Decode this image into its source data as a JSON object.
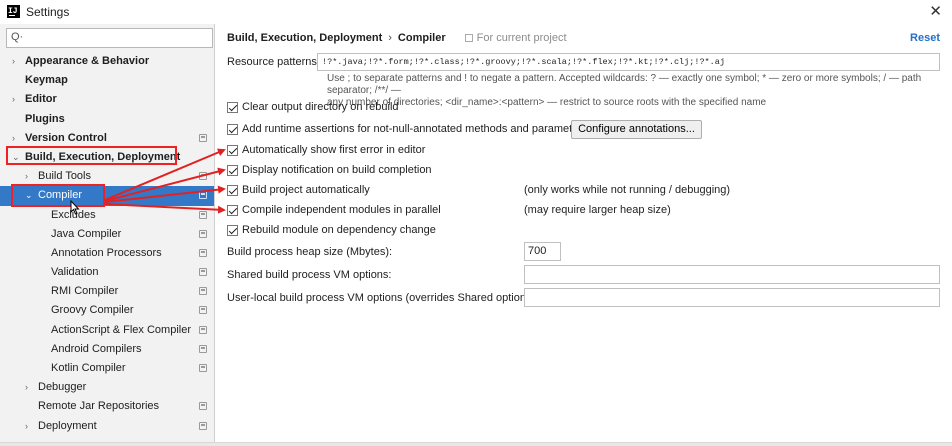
{
  "window": {
    "title": "Settings",
    "app_icon": "intellij-icon",
    "close_icon": "close-icon"
  },
  "search": {
    "placeholder": "",
    "value": "",
    "icon": "search-icon"
  },
  "tree": [
    {
      "label": "Appearance & Behavior",
      "bold": true,
      "expanded": false,
      "has_arrow": true,
      "indent": 0,
      "project_icon": false
    },
    {
      "label": "Keymap",
      "bold": true,
      "has_arrow": false,
      "indent": 0,
      "project_icon": false
    },
    {
      "label": "Editor",
      "bold": true,
      "expanded": false,
      "has_arrow": true,
      "indent": 0,
      "project_icon": false
    },
    {
      "label": "Plugins",
      "bold": true,
      "has_arrow": false,
      "indent": 0,
      "project_icon": false
    },
    {
      "label": "Version Control",
      "bold": true,
      "expanded": false,
      "has_arrow": true,
      "indent": 0,
      "project_icon": true
    },
    {
      "label": "Build, Execution, Deployment",
      "bold": true,
      "expanded": true,
      "has_arrow": true,
      "indent": 0,
      "project_icon": false
    },
    {
      "label": "Build Tools",
      "bold": false,
      "expanded": false,
      "has_arrow": true,
      "indent": 1,
      "project_icon": true
    },
    {
      "label": "Compiler",
      "bold": false,
      "expanded": true,
      "has_arrow": true,
      "indent": 1,
      "project_icon": true,
      "selected": true
    },
    {
      "label": "Excludes",
      "bold": false,
      "has_arrow": false,
      "indent": 2,
      "project_icon": true
    },
    {
      "label": "Java Compiler",
      "bold": false,
      "has_arrow": false,
      "indent": 2,
      "project_icon": true
    },
    {
      "label": "Annotation Processors",
      "bold": false,
      "has_arrow": false,
      "indent": 2,
      "project_icon": true
    },
    {
      "label": "Validation",
      "bold": false,
      "has_arrow": false,
      "indent": 2,
      "project_icon": true
    },
    {
      "label": "RMI Compiler",
      "bold": false,
      "has_arrow": false,
      "indent": 2,
      "project_icon": true
    },
    {
      "label": "Groovy Compiler",
      "bold": false,
      "has_arrow": false,
      "indent": 2,
      "project_icon": true
    },
    {
      "label": "ActionScript & Flex Compiler",
      "bold": false,
      "has_arrow": false,
      "indent": 2,
      "project_icon": true
    },
    {
      "label": "Android Compilers",
      "bold": false,
      "has_arrow": false,
      "indent": 2,
      "project_icon": true
    },
    {
      "label": "Kotlin Compiler",
      "bold": false,
      "has_arrow": false,
      "indent": 2,
      "project_icon": true
    },
    {
      "label": "Debugger",
      "bold": false,
      "expanded": false,
      "has_arrow": true,
      "indent": 1,
      "project_icon": false
    },
    {
      "label": "Remote Jar Repositories",
      "bold": false,
      "has_arrow": false,
      "indent": 1,
      "project_icon": true
    },
    {
      "label": "Deployment",
      "bold": false,
      "expanded": false,
      "has_arrow": true,
      "indent": 1,
      "project_icon": true
    }
  ],
  "header": {
    "crumb_parent": "Build, Execution, Deployment",
    "crumb_sep": "›",
    "crumb_current": "Compiler",
    "scope": "For current project",
    "reset": "Reset"
  },
  "resource_patterns": {
    "label": "Resource patterns:",
    "value": "!?*.java;!?*.form;!?*.class;!?*.groovy;!?*.scala;!?*.flex;!?*.kt;!?*.clj;!?*.aj",
    "hint_line1": "Use ; to separate patterns and ! to negate a pattern. Accepted wildcards: ? — exactly one symbol; * — zero or more symbols; / — path separator; /**/ —",
    "hint_line2": "any number of directories; <dir_name>:<pattern> — restrict to source roots with the specified name"
  },
  "options": {
    "clear_output": {
      "label": "Clear output directory on rebuild",
      "checked": true
    },
    "runtime_assertions": {
      "label": "Add runtime assertions for not-null-annotated methods and parameters",
      "checked": true
    },
    "configure_annotations": "Configure annotations...",
    "show_first_error": {
      "label": "Automatically show first error in editor",
      "checked": true
    },
    "display_notification": {
      "label": "Display notification on build completion",
      "checked": true
    },
    "build_auto": {
      "label": "Build project automatically",
      "checked": true,
      "note": "(only works while not running / debugging)"
    },
    "compile_parallel": {
      "label": "Compile independent modules in parallel",
      "checked": true,
      "note": "(may require larger heap size)"
    },
    "rebuild_dependency": {
      "label": "Rebuild module on dependency change",
      "checked": true
    }
  },
  "heap": {
    "label": "Build process heap size (Mbytes):",
    "value": "700"
  },
  "shared_vm": {
    "label": "Shared build process VM options:",
    "value": ""
  },
  "user_vm": {
    "label": "User-local build process VM options (overrides Shared options):",
    "value": ""
  },
  "annotation_color": "#e22222"
}
